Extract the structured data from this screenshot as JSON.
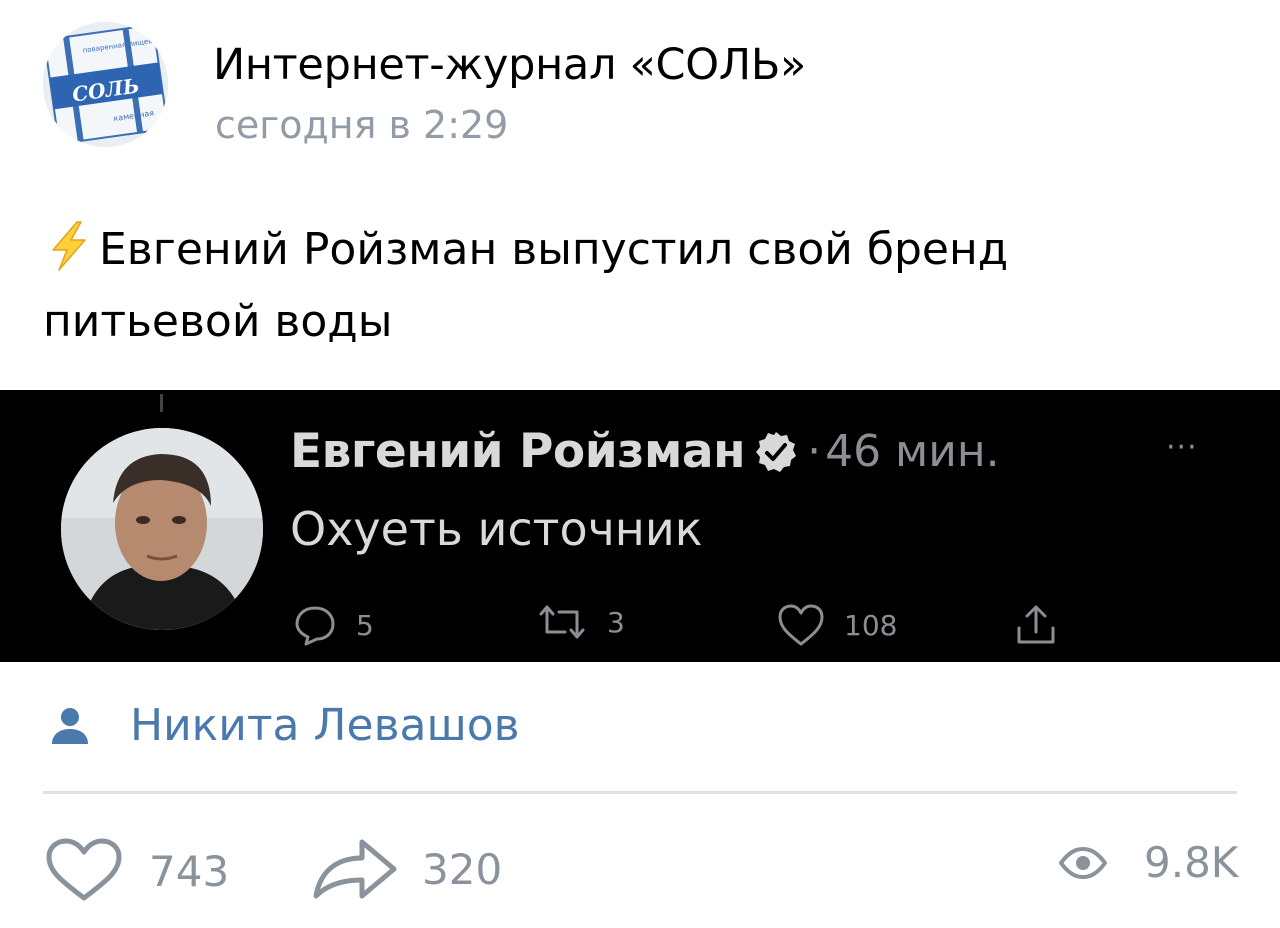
{
  "header": {
    "group_name": "Интернет-журнал «СОЛЬ»",
    "post_time": "сегодня в 2:29",
    "avatar_logo_text": "СОЛЬ",
    "avatar_logo_top_text": "поваренная пищевая",
    "avatar_logo_bottom_text": "каменная"
  },
  "post": {
    "icon": "lightning-icon",
    "text": "Евгений Ройзман выпустил свой бренд питьевой воды"
  },
  "tweet": {
    "author": "Евгений Ройзман",
    "separator": "·",
    "time": "46 мин.",
    "more": "···",
    "text": "Охуеть источник",
    "replies": "5",
    "retweets": "3",
    "likes": "108",
    "colors": {
      "background": "#000000",
      "text": "#d9d9d9",
      "muted": "#8b8f94"
    }
  },
  "signature": {
    "icon": "user-icon",
    "author": "Никита Левашов"
  },
  "footer": {
    "likes": "743",
    "shares": "320",
    "views": "9.8K"
  },
  "colors": {
    "link": "#4a79ad",
    "muted": "#8a929c",
    "divider": "#dde1e6"
  }
}
